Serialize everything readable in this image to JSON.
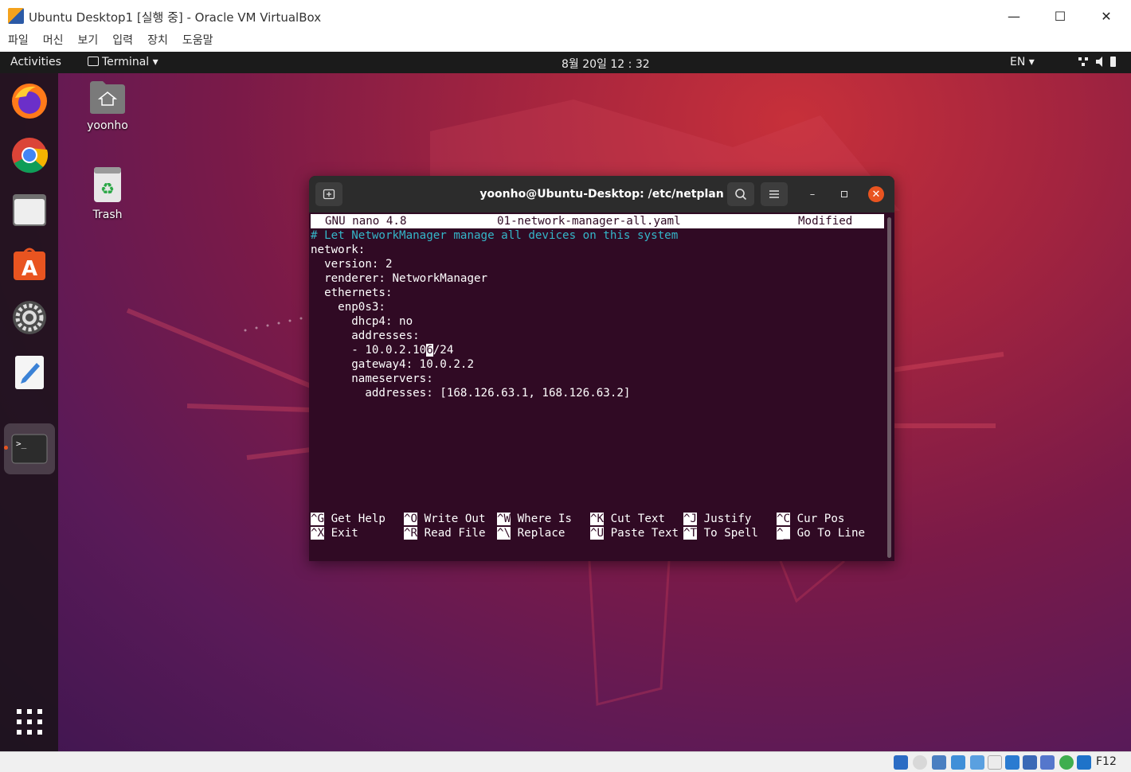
{
  "host": {
    "title": "Ubuntu Desktop1 [실행 중] - Oracle VM VirtualBox",
    "menu": [
      "파일",
      "머신",
      "보기",
      "입력",
      "장치",
      "도움말"
    ],
    "minimize": "—",
    "maximize": "☐",
    "close": "✕",
    "host_key": "F12"
  },
  "topbar": {
    "activities": "Activities",
    "app_menu": "Terminal",
    "clock": "8월 20일 12 : 32",
    "lang": "EN"
  },
  "desktop": {
    "home_label": "yoonho",
    "trash_label": "Trash"
  },
  "terminal": {
    "title": "yoonho@Ubuntu-Desktop: /etc/netplan",
    "nano": {
      "version": "GNU nano 4.8",
      "filename": "01-network-manager-all.yaml",
      "status": "Modified",
      "comment": "# Let NetworkManager manage all devices on this system",
      "lines": [
        "network:",
        "  version: 2",
        "  renderer: NetworkManager",
        "  ethernets:",
        "    enp0s3:",
        "      dhcp4: no",
        "      addresses:"
      ],
      "addr_pre": "      - 10.0.2.10",
      "addr_cursor": "6",
      "addr_post": "/24",
      "lines2": [
        "      gateway4: 10.0.2.2",
        "      nameservers:",
        "        addresses: [168.126.63.1, 168.126.63.2]"
      ],
      "shortcuts_row1": [
        {
          "key": "^G",
          "label": "Get Help"
        },
        {
          "key": "^O",
          "label": "Write Out"
        },
        {
          "key": "^W",
          "label": "Where Is"
        },
        {
          "key": "^K",
          "label": "Cut Text"
        },
        {
          "key": "^J",
          "label": "Justify"
        },
        {
          "key": "^C",
          "label": "Cur Pos"
        }
      ],
      "shortcuts_row2": [
        {
          "key": "^X",
          "label": "Exit"
        },
        {
          "key": "^R",
          "label": "Read File"
        },
        {
          "key": "^\\",
          "label": "Replace"
        },
        {
          "key": "^U",
          "label": "Paste Text"
        },
        {
          "key": "^T",
          "label": "To Spell"
        },
        {
          "key": "^_",
          "label": "Go To Line"
        }
      ]
    }
  }
}
